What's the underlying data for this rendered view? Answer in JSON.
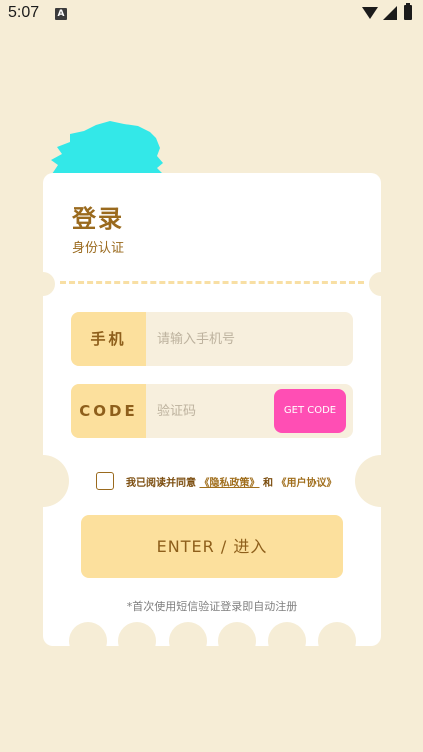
{
  "status_bar": {
    "time": "5:07",
    "notification_icon": "A"
  },
  "card": {
    "title": "登录",
    "subtitle": "身份认证",
    "phone": {
      "label": "手机",
      "placeholder": "请输入手机号",
      "value": ""
    },
    "code": {
      "label": "CODE",
      "placeholder": "验证码",
      "value": "",
      "get_code_label": "GET CODE"
    },
    "agreement": {
      "prefix": "我已阅读并同意",
      "privacy_link": "《隐私政策》",
      "conjunction": "和",
      "terms_link": "《用户协议》",
      "checked": false
    },
    "enter_label": "ENTER / 进入",
    "hint": "*首次使用短信验证登录即自动注册"
  },
  "colors": {
    "background": "#F6EDD6",
    "accent_yellow": "#FCE09D",
    "brown_text": "#9A6A1E",
    "get_code_pink": "#FF4EB4",
    "mascot_cyan": "#33E8E8"
  }
}
